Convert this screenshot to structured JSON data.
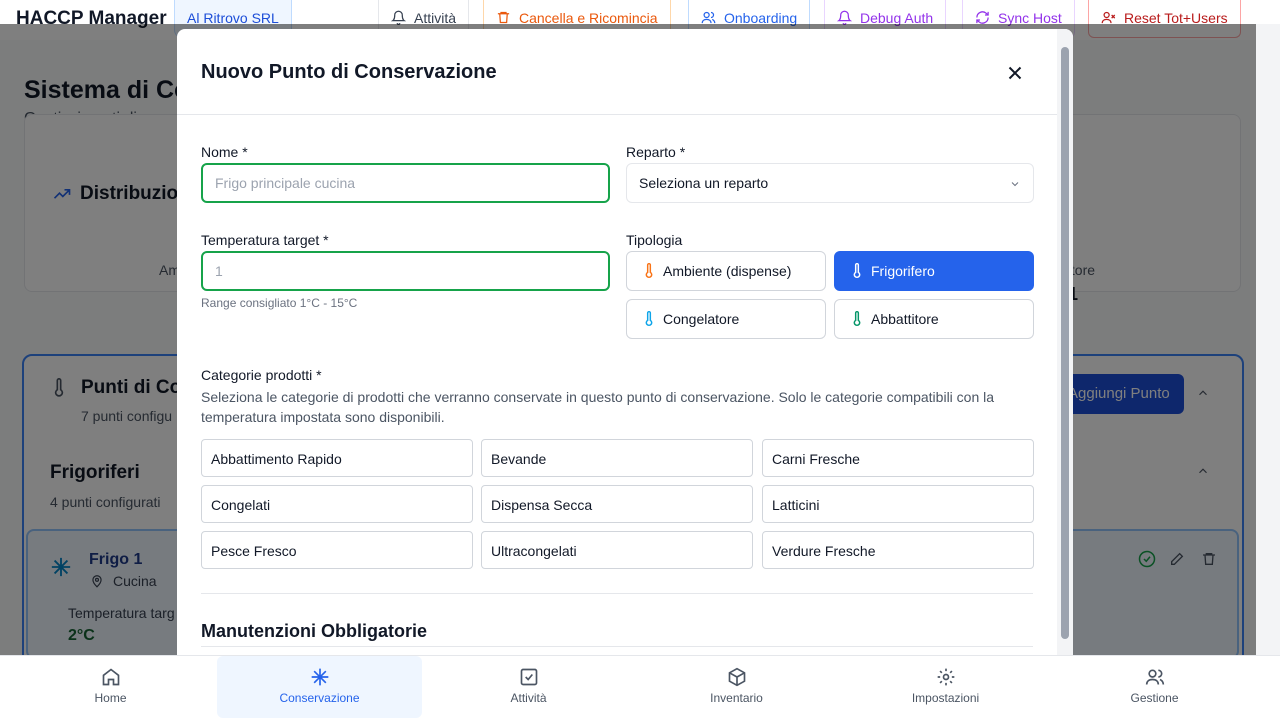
{
  "header": {
    "brand": "HACCP Manager",
    "company": "Al Ritrovo SRL",
    "buttons": [
      {
        "label": "Attività",
        "icon": "bell-icon",
        "color": "#374151"
      },
      {
        "label": "Cancella e Ricomincia",
        "icon": "trash-icon",
        "color": "#ea580c"
      },
      {
        "label": "Onboarding",
        "icon": "users-icon",
        "color": "#2563eb"
      },
      {
        "label": "Debug Auth",
        "icon": "bell-icon",
        "color": "#9333ea"
      },
      {
        "label": "Sync Host",
        "icon": "refresh-icon",
        "color": "#9333ea"
      },
      {
        "label": "Reset Tot+Users",
        "icon": "user-x-icon",
        "color": "#b91c1c"
      }
    ]
  },
  "page": {
    "title": "Sistema di Co",
    "subtitle": "Gestisci punti di con",
    "distribution_title": "Distribuzion",
    "ambient_label": "Am",
    "abbattitore_label": "ttitore",
    "abbattitore_value": "1",
    "points_title": "Punti di Co",
    "points_sub": "7 punti configu",
    "add_point": "Aggiungi Punto",
    "fridges_title": "Frigoriferi",
    "fridges_sub": "4 punti configurati",
    "frigo_name": "Frigo 1",
    "frigo_location": "Cucina",
    "temp_label": "Temperatura targ",
    "temp_value": "2°C"
  },
  "modal": {
    "title": "Nuovo Punto di Conservazione",
    "name_label": "Nome *",
    "name_placeholder": "Frigo principale cucina",
    "reparto_label": "Reparto *",
    "reparto_value": "Seleziona un reparto",
    "temp_label": "Temperatura target *",
    "temp_placeholder": "1",
    "temp_hint": "Range consigliato 1°C - 15°C",
    "tipologia_label": "Tipologia",
    "tipologie": [
      {
        "label": "Ambiente (dispense)",
        "icon_color": "#f97316",
        "active": false
      },
      {
        "label": "Frigorifero",
        "icon_color": "#ffffff",
        "active": true
      },
      {
        "label": "Congelatore",
        "icon_color": "#0ea5e9",
        "active": false
      },
      {
        "label": "Abbattitore",
        "icon_color": "#059669",
        "active": false
      }
    ],
    "categories_label": "Categorie prodotti *",
    "categories_desc": "Seleziona le categorie di prodotti che verranno conservate in questo punto di conservazione. Solo le categorie compatibili con la temperatura impostata sono disponibili.",
    "categories": [
      "Abbattimento Rapido",
      "Bevande",
      "Carni Fresche",
      "Congelati",
      "Dispensa Secca",
      "Latticini",
      "Pesce Fresco",
      "Ultracongelati",
      "Verdure Fresche"
    ],
    "maintenance_title": "Manutenzioni Obbligatorie"
  },
  "nav": [
    {
      "label": "Home",
      "icon": "home-icon",
      "active": false
    },
    {
      "label": "Conservazione",
      "icon": "snowflake-icon",
      "active": true
    },
    {
      "label": "Attività",
      "icon": "checkbox-icon",
      "active": false
    },
    {
      "label": "Inventario",
      "icon": "box-icon",
      "active": false
    },
    {
      "label": "Impostazioni",
      "icon": "gear-icon",
      "active": false
    },
    {
      "label": "Gestione",
      "icon": "users-icon",
      "active": false
    }
  ],
  "colors": {
    "primary": "#2563eb",
    "focus_border": "#16a34a",
    "overlay": "rgba(0,0,0,0.5)"
  }
}
